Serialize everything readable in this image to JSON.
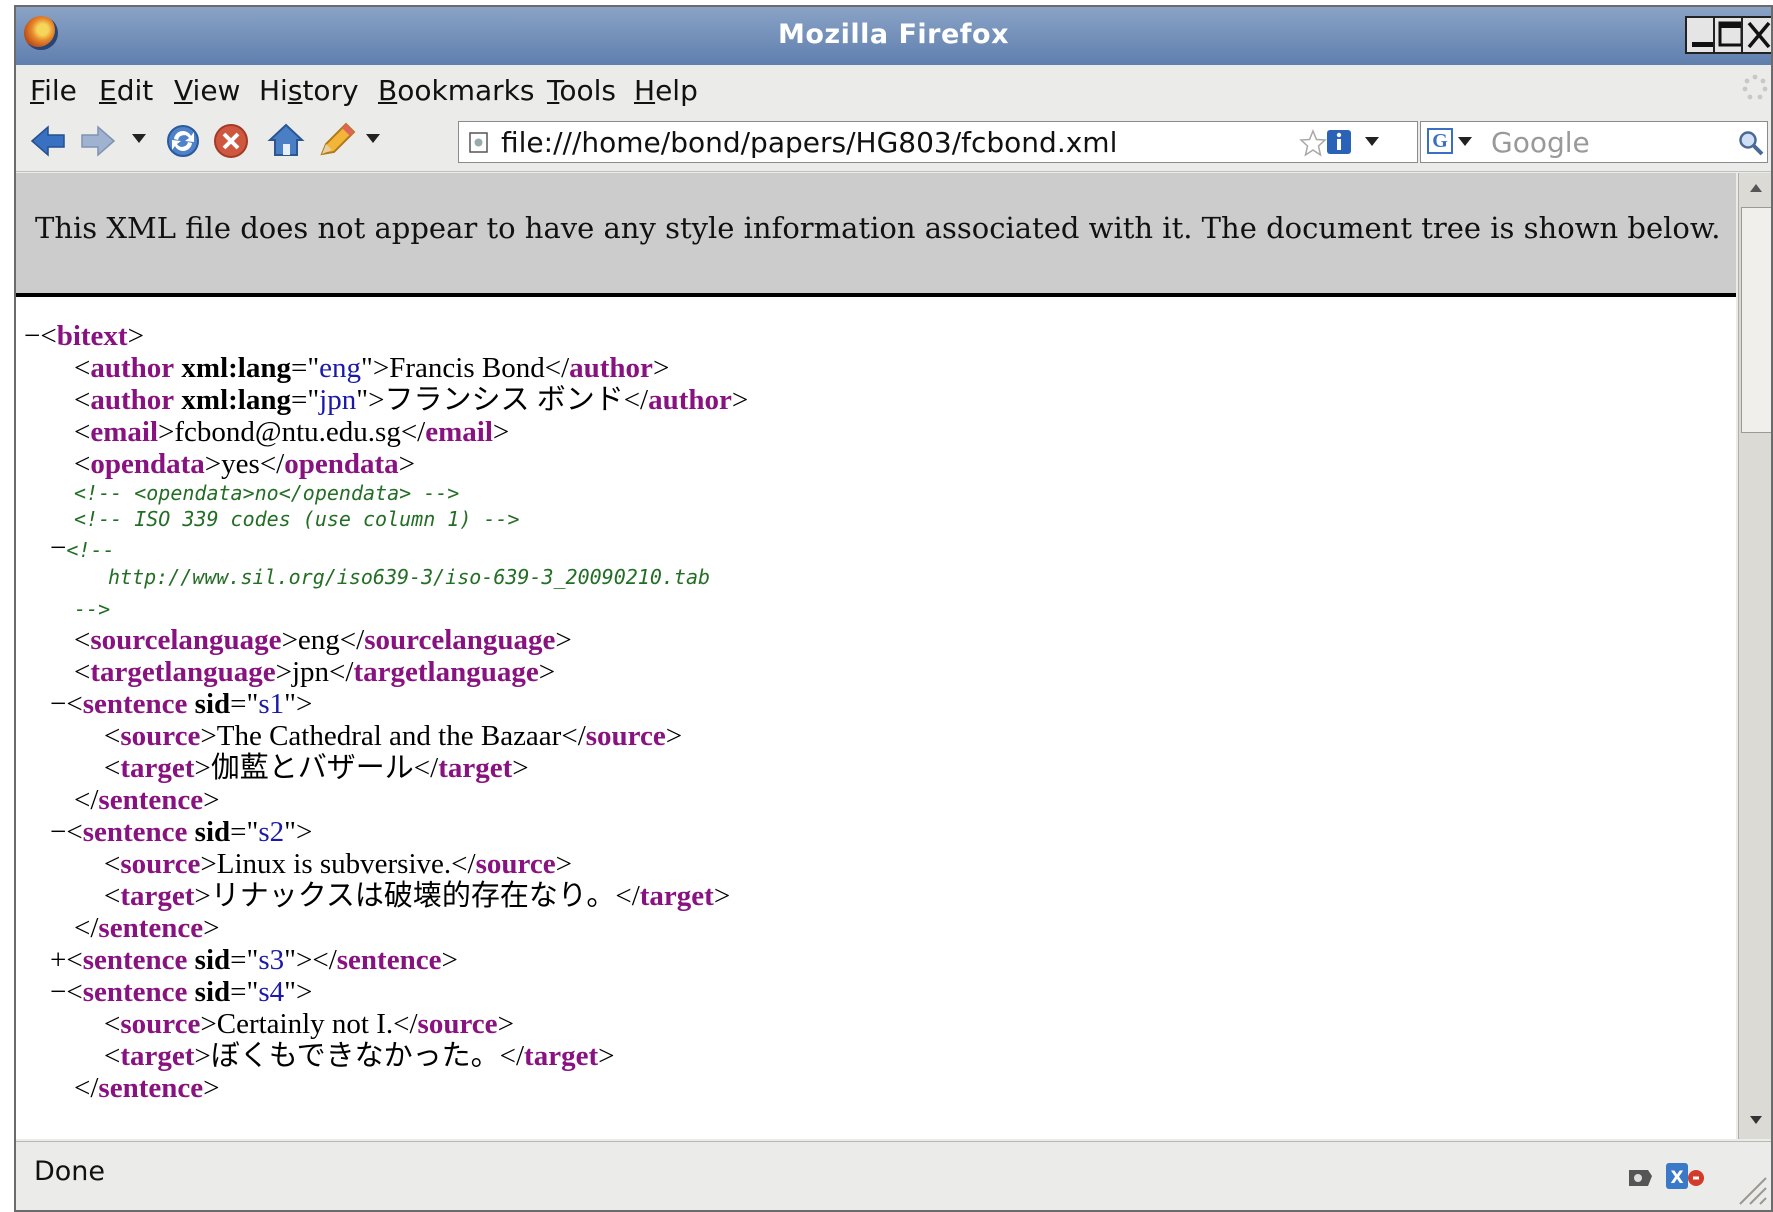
{
  "window": {
    "title": "Mozilla Firefox"
  },
  "menubar": {
    "items": [
      {
        "label": "File",
        "key": "F",
        "rest": "ile"
      },
      {
        "label": "Edit",
        "key": "E",
        "rest": "dit"
      },
      {
        "label": "View",
        "key": "V",
        "rest": "iew"
      },
      {
        "label": "History",
        "pre": "Hi",
        "key": "s",
        "rest": "tory"
      },
      {
        "label": "Bookmarks",
        "key": "B",
        "rest": "ookmarks"
      },
      {
        "label": "Tools",
        "key": "T",
        "rest": "ools"
      },
      {
        "label": "Help",
        "key": "H",
        "rest": "elp"
      }
    ]
  },
  "toolbar": {
    "url": "file:///home/bond/papers/HG803/fcbond.xml",
    "search_placeholder": "Google",
    "search_engine_letter": "G"
  },
  "content": {
    "xml_notice": "This XML file does not appear to have any style information associated with it. The document tree is shown below.",
    "root_tag": "bitext",
    "authors": [
      {
        "lang": "eng",
        "name": "Francis Bond"
      },
      {
        "lang": "jpn",
        "name": "フランシス ボンド"
      }
    ],
    "email": "fcbond@ntu.edu.sg",
    "opendata": "yes",
    "comment1": "<!-- <opendata>no</opendata> -->",
    "comment2": "<!-- ISO 339 codes (use column 1) -->",
    "comment3_open": "<!--",
    "comment3_url": "http://www.sil.org/iso639-3/iso-639-3_20090210.tab",
    "comment3_close": "-->",
    "sourcelanguage": "eng",
    "targetlanguage": "jpn",
    "sentences": [
      {
        "sid": "s1",
        "source": "The Cathedral and the Bazaar",
        "target": "伽藍とバザール"
      },
      {
        "sid": "s2",
        "source": "Linux is subversive.",
        "target": "リナックスは破壊的存在なり。"
      },
      {
        "sid": "s3"
      },
      {
        "sid": "s4",
        "source": "Certainly not I.",
        "target": "ぼくもできなかった。"
      }
    ]
  },
  "statusbar": {
    "text": "Done"
  }
}
